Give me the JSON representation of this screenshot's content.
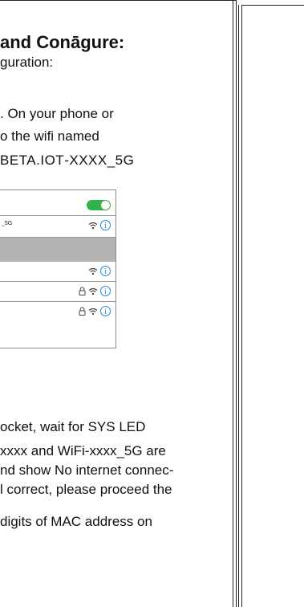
{
  "page": {
    "title": "and Conāgure:",
    "subtitle": "guration:",
    "step_phone_line1": ". On your phone or",
    "step_phone_line2": "o the wifi named",
    "step_phone_line3": "BETA.IOT‑XXXX_5G"
  },
  "phone_screen": {
    "row1_label": "_5G",
    "toggle_on": true,
    "colors": {
      "toggle": "#2fb34a",
      "info": "#1e88e5",
      "selected_row": "#b3b3b3"
    },
    "icons": {
      "wifi": "wifi-icon",
      "info": "info-icon",
      "lock": "lock-icon"
    },
    "info_glyph": "i"
  },
  "body": {
    "line1": "ocket, wait for SYS LED",
    "line2": "xxxx and WiFi‑xxxx_5G are",
    "line3": "nd show No internet connec-",
    "line4": "l correct, please proceed the",
    "line5": " digits of MAC address on"
  }
}
